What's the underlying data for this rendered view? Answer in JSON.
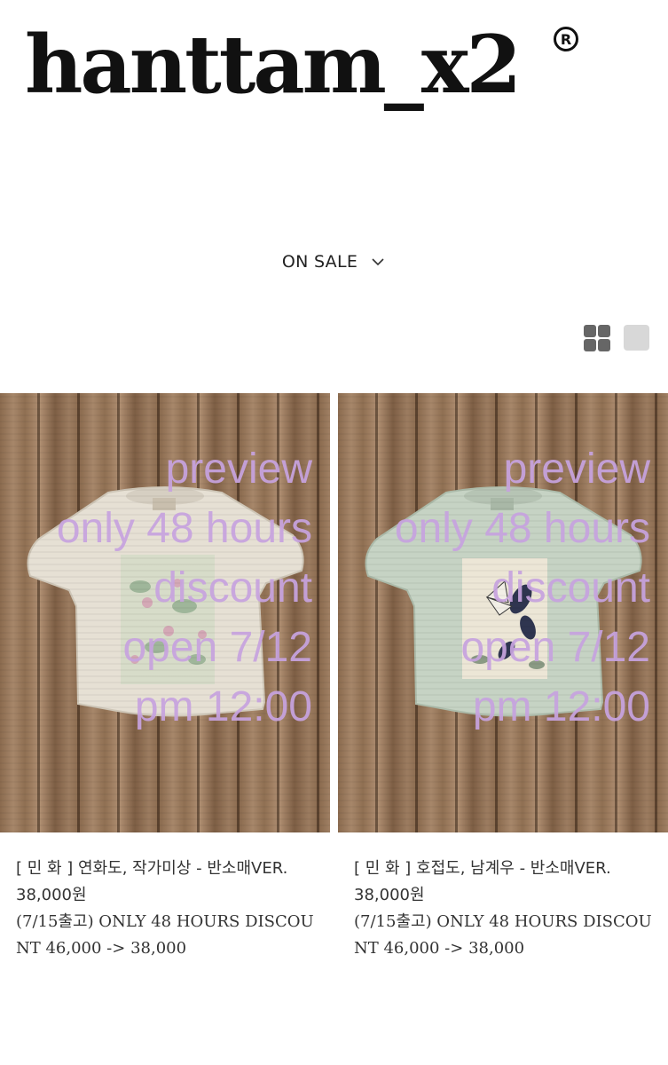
{
  "brand": {
    "logo_text": "hanttam_x2",
    "registered_mark": "R"
  },
  "category_selector": {
    "label": "ON SALE"
  },
  "view_toggle": {
    "grid_view": "grid-icon",
    "single_view": "single-view-icon"
  },
  "products": [
    {
      "overlay_lines": [
        "preview",
        "only 48 hours",
        "discount",
        "open 7/12",
        "pm 12:00"
      ],
      "name": "[ 민 화 ] 연화도, 작가미상 - 반소매VER.",
      "price": "38,000원",
      "description": "(7/15출고) ONLY 48 HOURS DISCOUNT 46,000 -> 38,000",
      "shirt_color": "#e6e0d4"
    },
    {
      "overlay_lines": [
        "preview",
        "only 48 hours",
        "discount",
        "open 7/12",
        "pm 12:00"
      ],
      "name": "[ 민 화 ] 호접도, 남계우 - 반소매VER.",
      "price": "38,000원",
      "description": "(7/15출고) ONLY 48 HOURS DISCOUNT 46,000 -> 38,000",
      "shirt_color": "#c6d3c4"
    }
  ],
  "colors": {
    "overlay_text": "#c7a3df",
    "wood": "#8f6f52"
  }
}
